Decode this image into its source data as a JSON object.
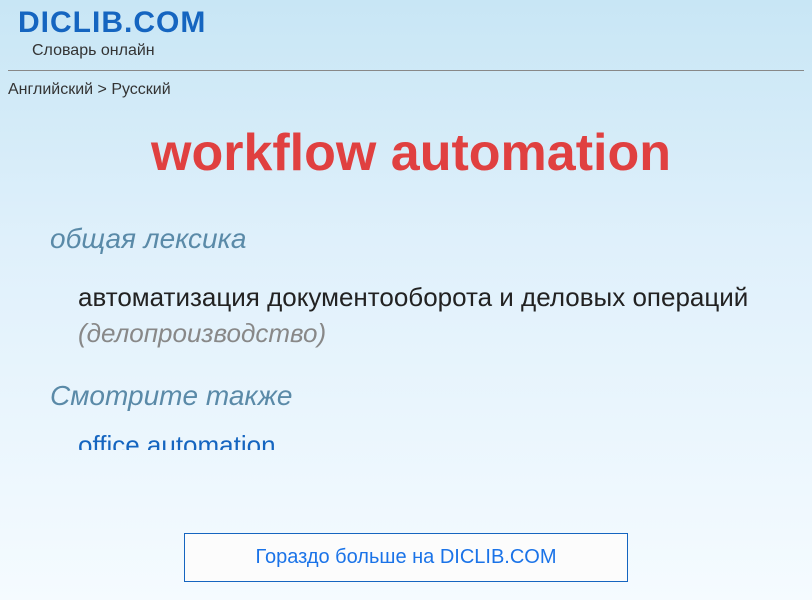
{
  "header": {
    "site_title": "DICLIB.COM",
    "site_subtitle": "Словарь онлайн"
  },
  "breadcrumb": {
    "text": "Английский > Русский"
  },
  "entry": {
    "term": "workflow automation",
    "category": "общая лексика",
    "definition_main": "автоматизация документооборота и деловых операций ",
    "definition_note": "(делопроизводство)"
  },
  "see_also": {
    "heading": "Смотрите также",
    "item": "office automation"
  },
  "cta": {
    "label": "Гораздо больше на DICLIB.COM"
  }
}
